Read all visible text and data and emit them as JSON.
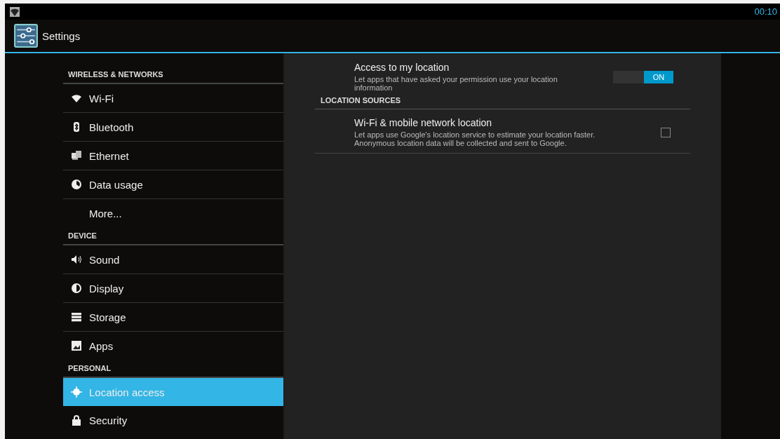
{
  "status_bar": {
    "time": "00:10"
  },
  "action_bar": {
    "title": "Settings"
  },
  "sidebar": {
    "sections": [
      {
        "header": "WIRELESS & NETWORKS",
        "items": [
          {
            "label": "Wi-Fi",
            "kind": "wifi",
            "selected": false
          },
          {
            "label": "Bluetooth",
            "kind": "bluetooth",
            "selected": false
          },
          {
            "label": "Ethernet",
            "kind": "ethernet",
            "selected": false
          },
          {
            "label": "Data usage",
            "kind": "data",
            "selected": false
          },
          {
            "label": "More...",
            "kind": "none",
            "selected": false
          }
        ]
      },
      {
        "header": "DEVICE",
        "items": [
          {
            "label": "Sound",
            "kind": "sound",
            "selected": false
          },
          {
            "label": "Display",
            "kind": "display",
            "selected": false
          },
          {
            "label": "Storage",
            "kind": "storage",
            "selected": false
          },
          {
            "label": "Apps",
            "kind": "apps",
            "selected": false
          }
        ]
      },
      {
        "header": "PERSONAL",
        "items": [
          {
            "label": "Location access",
            "kind": "location",
            "selected": true
          },
          {
            "label": "Security",
            "kind": "lock",
            "selected": false
          }
        ]
      }
    ]
  },
  "detail": {
    "rows": [
      {
        "kind": "toggle",
        "title": "Access to my location",
        "summary": "Let apps that have asked your permission use your location information",
        "on": true,
        "toggle_label": "ON"
      },
      {
        "kind": "header",
        "title": "LOCATION SOURCES"
      },
      {
        "kind": "checkbox",
        "title": "Wi-Fi & mobile network location",
        "summary": "Let apps use Google's location service to estimate your location faster. Anonymous location data will be collected and sent to Google.",
        "checked": false
      }
    ]
  }
}
